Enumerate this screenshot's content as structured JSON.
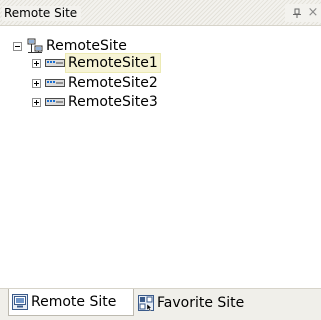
{
  "panel": {
    "title": "Remote Site",
    "pin_icon": "pin-icon",
    "close_icon": "close-icon"
  },
  "tree": {
    "root": {
      "label": "RemoteSite",
      "icon": "network-icon",
      "expanded": true
    },
    "children": [
      {
        "label": "RemoteSite1",
        "icon": "server-icon",
        "selected": true,
        "expanded": false
      },
      {
        "label": "RemoteSite2",
        "icon": "server-icon",
        "selected": false,
        "expanded": false
      },
      {
        "label": "RemoteSite3",
        "icon": "server-icon",
        "selected": false,
        "expanded": false
      }
    ]
  },
  "tabs": [
    {
      "label": "Remote Site",
      "icon": "remote-site-tab-icon",
      "active": true
    },
    {
      "label": "Favorite Site",
      "icon": "favorite-site-tab-icon",
      "active": false
    }
  ],
  "colors": {
    "selection_background": "#f7f4d6",
    "titlebar_background": "#f3f2ee",
    "tabstrip_background": "#f0efea"
  }
}
